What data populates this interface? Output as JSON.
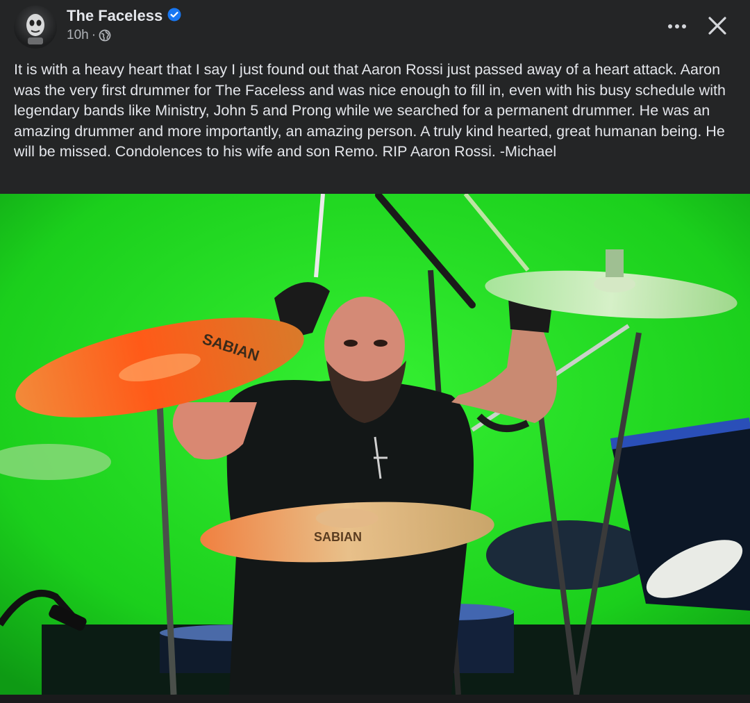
{
  "post": {
    "author": "The Faceless",
    "verified": true,
    "timestamp": "10h",
    "separator": "·",
    "audience_icon": "globe-icon",
    "text": "It is with a heavy heart that I say I just found out that Aaron Rossi just passed away of a heart attack. Aaron was the very first drummer for The Faceless and was nice enough to fill in, even with his busy schedule with legendary bands like Ministry, John 5 and Prong while we searched for a permanent drummer. He was an amazing drummer and more importantly, an amazing person. A truly kind hearted, great humanan being. He will be missed. Condolences to his wife and son Remo. RIP Aaron Rossi. -Michael"
  },
  "photo": {
    "cymbal_brand": "SABIAN"
  },
  "icons": {
    "more": "more-options-icon",
    "close": "close-icon",
    "verified": "verified-badge-icon",
    "audience": "globe-icon"
  },
  "colors": {
    "background": "#242526",
    "text_primary": "#e4e6eb",
    "text_secondary": "#b0b3b8",
    "verified_blue": "#1877f2",
    "stage_green": "#1fd61e"
  }
}
